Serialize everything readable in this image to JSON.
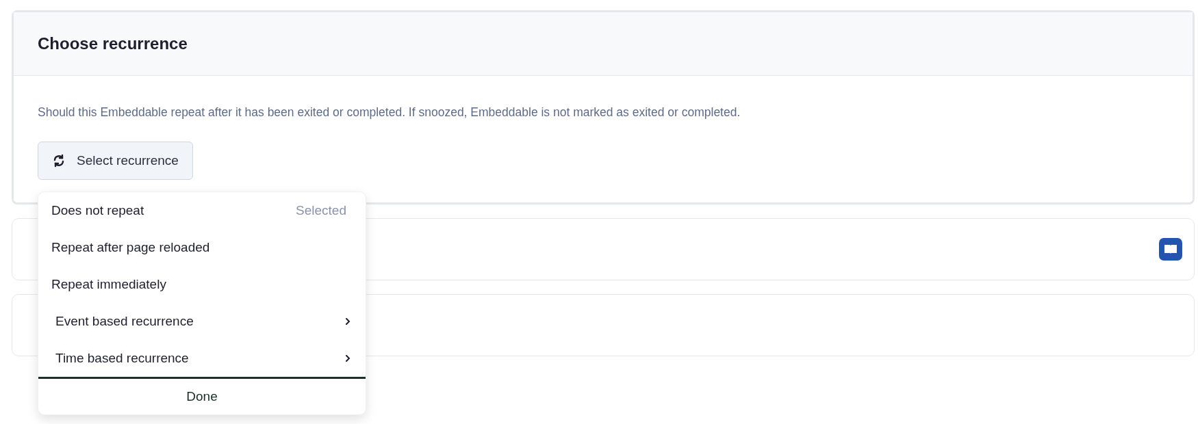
{
  "card": {
    "title": "Choose recurrence",
    "description": "Should this Embeddable repeat after it has been exited or completed. If snoozed, Embeddable is not marked as exited or completed.",
    "button": "Select recurrence"
  },
  "dropdown": {
    "selected_text": "Selected",
    "items": [
      {
        "label": "Does not repeat",
        "kind": "option",
        "selected": true
      },
      {
        "label": "Repeat after page reloaded",
        "kind": "option",
        "selected": false
      },
      {
        "label": "Repeat immediately",
        "kind": "option",
        "selected": false
      },
      {
        "label": "Event based recurrence",
        "kind": "submenu",
        "selected": false
      },
      {
        "label": "Time based recurrence",
        "kind": "submenu",
        "selected": false
      }
    ],
    "done": "Done"
  }
}
